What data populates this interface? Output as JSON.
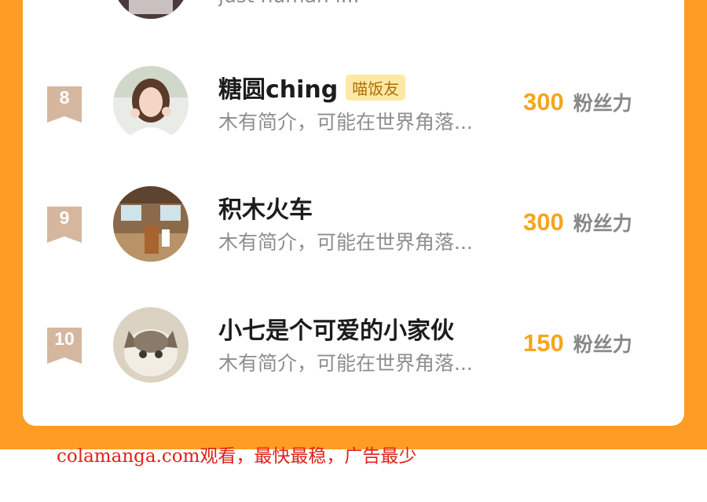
{
  "top_partial": {
    "bio": "just human i..."
  },
  "rows": [
    {
      "rank": "8",
      "name": "糖圆ching",
      "tag": "喵饭友",
      "bio": "木有简介，可能在世界角落...",
      "score": "300",
      "unit": "粉丝力"
    },
    {
      "rank": "9",
      "name": "积木火车",
      "bio": "木有简介，可能在世界角落...",
      "score": "300",
      "unit": "粉丝力"
    },
    {
      "rank": "10",
      "name": "小七是个可爱的小家伙",
      "bio": "木有简介，可能在世界角落...",
      "score": "150",
      "unit": "粉丝力"
    }
  ],
  "watermark": "colamanga.com观看，最快最稳，广告最少",
  "colors": {
    "frame": "#fe9c23",
    "score": "#f6a51d",
    "badge": "#d5b7a0",
    "tag_bg": "#fde9a5"
  }
}
